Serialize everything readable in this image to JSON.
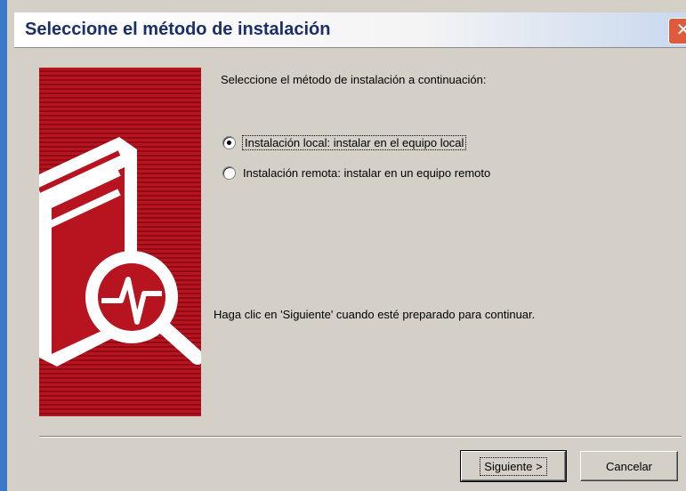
{
  "window": {
    "title": "Seleccione el método de instalación",
    "close_label": "✕"
  },
  "main": {
    "prompt": "Seleccione el método de instalación a continuación:",
    "options": [
      {
        "label": "Instalación local: instalar en el equipo local",
        "checked": true
      },
      {
        "label": "Instalación remota: instalar en un equipo remoto",
        "checked": false
      }
    ],
    "hint": "Haga clic en 'Siguiente' cuando esté preparado para continuar."
  },
  "buttons": {
    "next_label": "Siguiente >",
    "cancel_label": "Cancelar"
  },
  "colors": {
    "banner_red": "#b81420",
    "title_text": "#1a2f6b",
    "dialog_bg": "#d4d0c8"
  },
  "icons": {
    "banner": "server-monitor-icon",
    "close": "close-icon"
  }
}
